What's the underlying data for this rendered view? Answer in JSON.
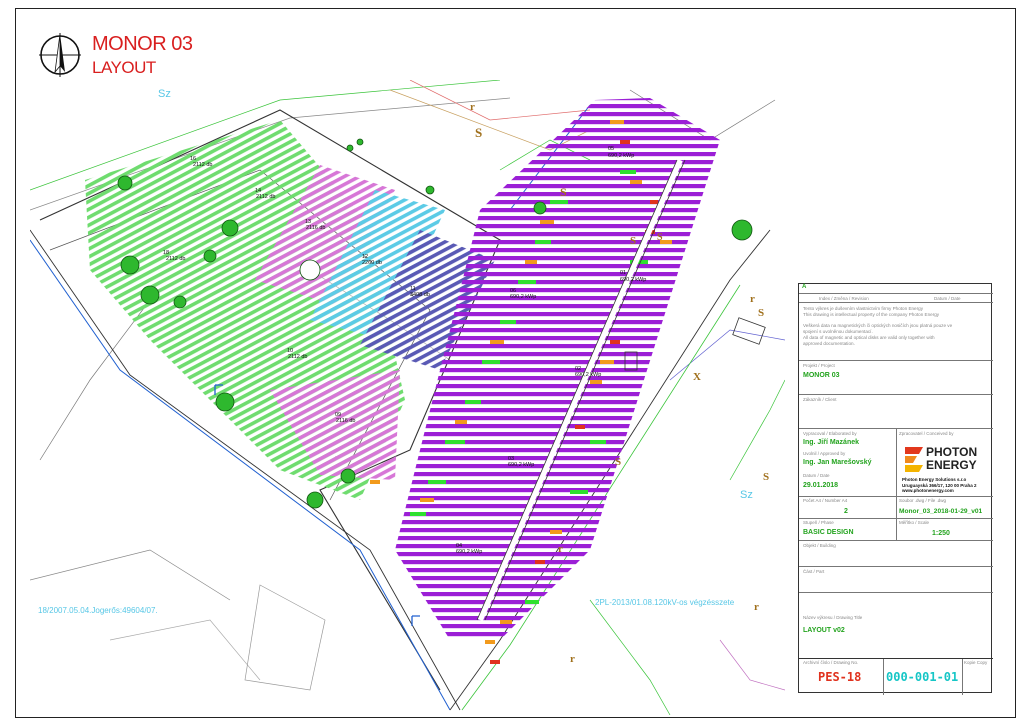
{
  "title": {
    "line1": "MONOR 03",
    "line2": "LAYOUT"
  },
  "colors": {
    "title_red": "#d91f1f",
    "field_green": "#6fdc6f",
    "field_pink": "#d777d7",
    "field_cyan": "#5ccbe6",
    "field_navy": "#5a5ab5",
    "panels_purple": "#9b1fd6",
    "edge_green": "#2ee02e",
    "edge_orange": "#f29a1c",
    "edge_red": "#e0321e",
    "value_green": "#23a31e",
    "stamp_red": "#e0321e",
    "stamp_cyan": "#16c6c6"
  },
  "drawing": {
    "field_labels": [
      {
        "id": "16",
        "count": "2112 db"
      },
      {
        "id": "14",
        "count": "2112 db"
      },
      {
        "id": "13",
        "count": "2116 db"
      },
      {
        "id": "12",
        "count": "2260 db"
      },
      {
        "id": "11",
        "count": "3408 db"
      },
      {
        "id": "18",
        "count": "2112 db"
      },
      {
        "id": "10",
        "count": "2112 db"
      },
      {
        "id": "09",
        "count": "2116 db"
      }
    ],
    "station_labels": [
      {
        "id": "05",
        "power": "690,2 kWp"
      },
      {
        "id": "01",
        "power": "690,2 kWp"
      },
      {
        "id": "06",
        "power": "690,2 kWp"
      },
      {
        "id": "02",
        "power": "690,2 kWp"
      },
      {
        "id": "03",
        "power": "690,2 kWp"
      },
      {
        "id": "04",
        "power": "690,2 kWp"
      }
    ],
    "map_text_left": "18/2007.05.04.Jogerős:49604/07.",
    "map_text_right": "2PL-2013/01.08.120kV-os végzésszete"
  },
  "titleblock": {
    "rev_letter": "A",
    "rev_labels": "Index  /  Změna  /  Revision",
    "rev_date_label": "Datum  /  Date",
    "note_lines": [
      "Tento výkres je duševním vlastnictvím firmy Photon Energy",
      "This drawing is intellectual property of the company Photon Energy",
      "Veškerá data na magnetických či optických nosičích jsou platná pouze ve",
      "spojení s uvolněnou dokumentací.",
      "All data of magnetic and optical disks are valid only together with",
      "approved documentation."
    ],
    "project_label": "Projekt  /  Project",
    "project_value": "MONOR 03",
    "client_label": "Zákazník  /  Client",
    "drawn_label": "Vypracoval  /  Elaborated by",
    "drawn_value": "Ing. Jiří Mazánek",
    "approved_label": "Uvolnil  /  Approved by",
    "approved_value": "Ing. Jan Marešovský",
    "date_label": "Datum  /  Date",
    "date_value": "29.01.2018",
    "conceived_label": "Zpracovatel  /  Conceived by",
    "company_name_1": "PHOTON",
    "company_name_2": "ENERGY",
    "company_addr_1": "Photon Energy Solutions s.r.o",
    "company_addr_2": "Uruguayská 366/17,  120 00 Praha 2",
    "company_addr_3": "www.photonenergy.com",
    "sheets_label": "Počet A4  /  Number A4",
    "sheets_value": "2",
    "file_label": "Soubor .dwg  /  File .dwg",
    "file_value": "Monor_03_2018-01-29_v01",
    "phase_label": "Stupeň  /  Phase",
    "phase_value": "BASIC DESIGN",
    "scale_label": "Měřítko  /  Scale",
    "scale_value": "1:250",
    "building_label": "Objekt  /  Building",
    "part_label": "Část  /  Part",
    "drawing_title_label": "Název výkresu  /  Drawing Title",
    "drawing_title_value": "LAYOUT v02",
    "archive_label": "Archivní číslo  /  Drawing No.",
    "archive_value": "PES-18",
    "drawing_no_value": "000-001-01",
    "copy_label": "Kopie  Copy"
  }
}
